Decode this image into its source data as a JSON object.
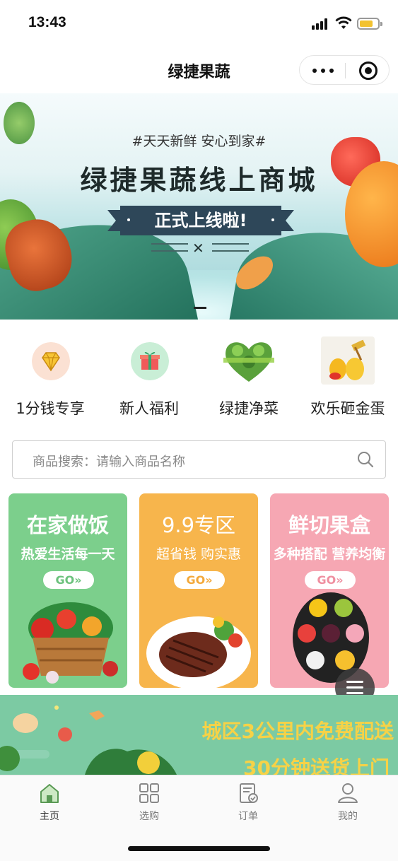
{
  "status_bar": {
    "time": "13:43"
  },
  "nav": {
    "title": "绿捷果蔬"
  },
  "banner": {
    "tagline": "#天天新鲜 安心到家#",
    "title": "绿捷果蔬线上商城",
    "ribbon": "正式上线啦!"
  },
  "categories": [
    {
      "label": "1分钱专享",
      "icon": "diamond-icon"
    },
    {
      "label": "新人福利",
      "icon": "gift-icon"
    },
    {
      "label": "绿捷净菜",
      "icon": "vegetable-heart-icon"
    },
    {
      "label": "欢乐砸金蛋",
      "icon": "golden-egg-icon"
    }
  ],
  "search": {
    "placeholder": "商品搜索：请输入商品名称"
  },
  "promos": [
    {
      "title": "在家做饭",
      "subtitle": "热爱生活每一天",
      "button": "GO»",
      "color": "#7ccf8c",
      "button_color": "#6cc27d"
    },
    {
      "title": "9.9专区",
      "subtitle": "超省钱 购实惠",
      "button": "GO»",
      "color": "#f7b54c",
      "button_color": "#f3a93b"
    },
    {
      "title": "鲜切果盒",
      "subtitle": "多种搭配 营养均衡",
      "button": "GO»",
      "color": "#f6a7b3",
      "button_color": "#ef8fa0"
    }
  ],
  "delivery": {
    "line1": "城区3公里内免费配送",
    "line2": "30分钟送货上门"
  },
  "tabs": [
    {
      "label": "主页",
      "icon": "home-icon",
      "active": true
    },
    {
      "label": "选购",
      "icon": "grid-icon",
      "active": false
    },
    {
      "label": "订单",
      "icon": "order-icon",
      "active": false
    },
    {
      "label": "我的",
      "icon": "user-icon",
      "active": false
    }
  ]
}
